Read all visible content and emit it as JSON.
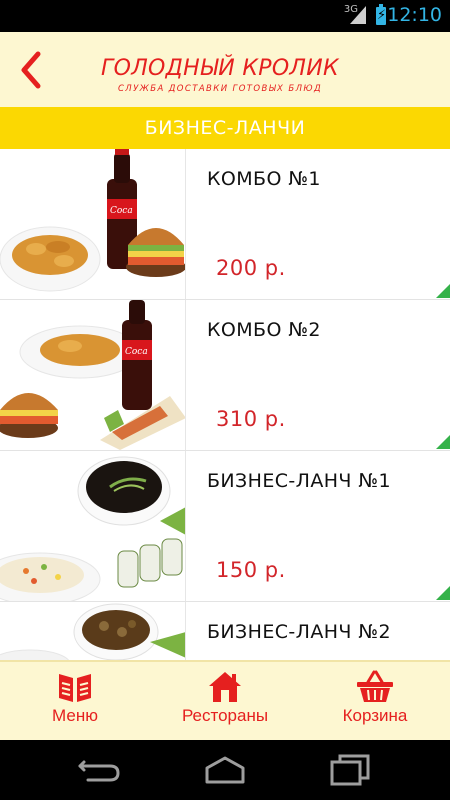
{
  "status_bar": {
    "network": "3G",
    "time": "12:10",
    "icons": [
      "signal-icon",
      "battery-charging-icon"
    ]
  },
  "header": {
    "title": "ГОЛОДНЫЙ КРОЛИК",
    "subtitle": "СЛУЖБА ДОСТАВКИ ГОТОВЫХ БЛЮД",
    "back_icon": "back-arrow-icon"
  },
  "category": {
    "label": "БИЗНЕС-ЛАНЧИ"
  },
  "items": [
    {
      "name": "КОМБО №1",
      "price": "200 р.",
      "image": "combo-fries-burger-cola"
    },
    {
      "name": "КОМБО №2",
      "price": "310 р.",
      "image": "combo-burger-fries-wrap-cola"
    },
    {
      "name": "БИЗНЕС-ЛАНЧ №1",
      "price": "150 р.",
      "image": "soup-rice-salad-rolls"
    },
    {
      "name": "БИЗНЕС-ЛАНЧ №2",
      "price": "",
      "image": "mushroom-soup-salad"
    }
  ],
  "tabs": [
    {
      "label": "Меню",
      "icon": "menu-book-icon"
    },
    {
      "label": "Рестораны",
      "icon": "home-icon"
    },
    {
      "label": "Корзина",
      "icon": "basket-icon"
    }
  ],
  "nav": {
    "icons": [
      "nav-back-icon",
      "nav-home-icon",
      "nav-recents-icon"
    ]
  },
  "colors": {
    "brand_red": "#e5201f",
    "category_yellow": "#fbd802",
    "header_cream": "#fdf7d1",
    "corner_green": "#35b24a",
    "status_blue": "#33b5e5"
  }
}
